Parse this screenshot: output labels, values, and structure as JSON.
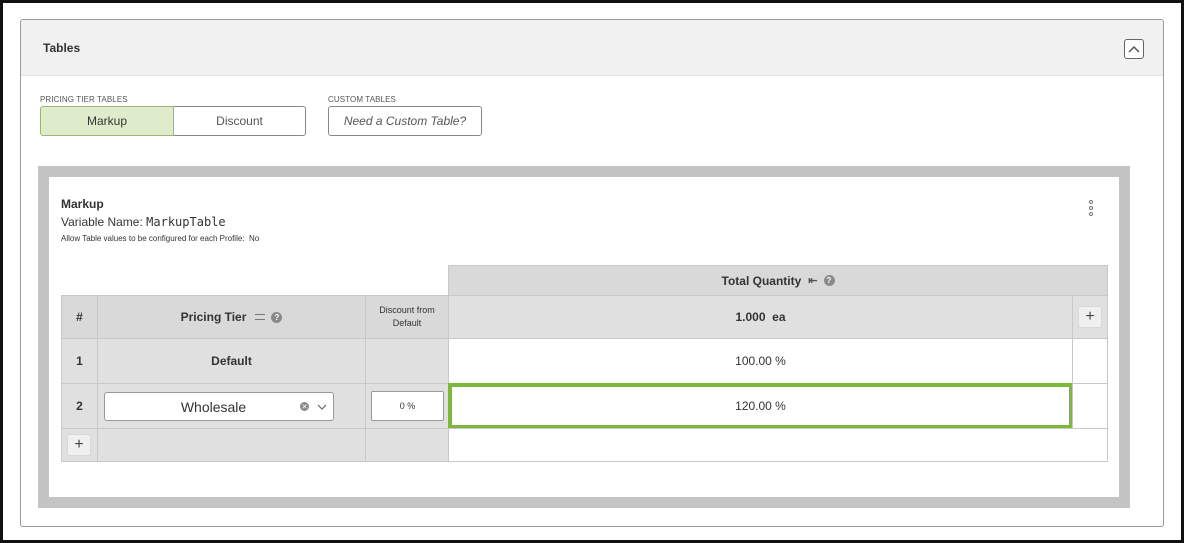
{
  "panel": {
    "title": "Tables"
  },
  "pricing_tier_tables": {
    "label": "PRICING TIER TABLES",
    "buttons": [
      {
        "label": "Markup",
        "active": true
      },
      {
        "label": "Discount",
        "active": false
      }
    ]
  },
  "custom_tables": {
    "label": "CUSTOM TABLES",
    "button_label": "Need a Custom Table?"
  },
  "table": {
    "title": "Markup",
    "variable_label": "Variable Name: ",
    "variable_name": "MarkupTable",
    "profile_label": "Allow Table values to be configured for each Profile:",
    "profile_value": "No",
    "header": {
      "total_quantity": "Total Quantity",
      "index": "#",
      "pricing_tier": "Pricing Tier",
      "discount_from_default": "Discount from Default",
      "quantity_value": "1.000",
      "quantity_unit": "ea",
      "help": "?"
    },
    "rows": [
      {
        "index": "1",
        "tier": "Default",
        "discount": "",
        "value": "100.00 %"
      },
      {
        "index": "2",
        "tier": "Wholesale",
        "discount": "0 %",
        "value": "120.00 %"
      }
    ],
    "add_label": "+"
  },
  "colors": {
    "active_green": "#dfeccb",
    "highlight_green": "#7cb83b"
  },
  "icons": [
    "collapse-up-icon",
    "kebab-menu-icon",
    "sort-icon",
    "help-icon",
    "collapse-column-icon",
    "plus-icon",
    "clear-icon",
    "chevron-down-icon"
  ]
}
